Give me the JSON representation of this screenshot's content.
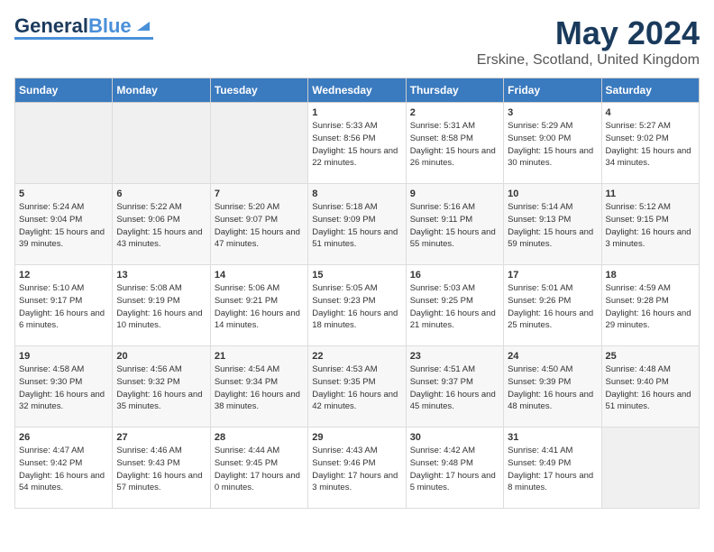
{
  "header": {
    "logo_line1": "General",
    "logo_line2": "Blue",
    "month": "May 2024",
    "location": "Erskine, Scotland, United Kingdom"
  },
  "weekdays": [
    "Sunday",
    "Monday",
    "Tuesday",
    "Wednesday",
    "Thursday",
    "Friday",
    "Saturday"
  ],
  "weeks": [
    [
      {
        "day": "",
        "sunrise": "",
        "sunset": "",
        "daylight": ""
      },
      {
        "day": "",
        "sunrise": "",
        "sunset": "",
        "daylight": ""
      },
      {
        "day": "",
        "sunrise": "",
        "sunset": "",
        "daylight": ""
      },
      {
        "day": "1",
        "sunrise": "Sunrise: 5:33 AM",
        "sunset": "Sunset: 8:56 PM",
        "daylight": "Daylight: 15 hours and 22 minutes."
      },
      {
        "day": "2",
        "sunrise": "Sunrise: 5:31 AM",
        "sunset": "Sunset: 8:58 PM",
        "daylight": "Daylight: 15 hours and 26 minutes."
      },
      {
        "day": "3",
        "sunrise": "Sunrise: 5:29 AM",
        "sunset": "Sunset: 9:00 PM",
        "daylight": "Daylight: 15 hours and 30 minutes."
      },
      {
        "day": "4",
        "sunrise": "Sunrise: 5:27 AM",
        "sunset": "Sunset: 9:02 PM",
        "daylight": "Daylight: 15 hours and 34 minutes."
      }
    ],
    [
      {
        "day": "5",
        "sunrise": "Sunrise: 5:24 AM",
        "sunset": "Sunset: 9:04 PM",
        "daylight": "Daylight: 15 hours and 39 minutes."
      },
      {
        "day": "6",
        "sunrise": "Sunrise: 5:22 AM",
        "sunset": "Sunset: 9:06 PM",
        "daylight": "Daylight: 15 hours and 43 minutes."
      },
      {
        "day": "7",
        "sunrise": "Sunrise: 5:20 AM",
        "sunset": "Sunset: 9:07 PM",
        "daylight": "Daylight: 15 hours and 47 minutes."
      },
      {
        "day": "8",
        "sunrise": "Sunrise: 5:18 AM",
        "sunset": "Sunset: 9:09 PM",
        "daylight": "Daylight: 15 hours and 51 minutes."
      },
      {
        "day": "9",
        "sunrise": "Sunrise: 5:16 AM",
        "sunset": "Sunset: 9:11 PM",
        "daylight": "Daylight: 15 hours and 55 minutes."
      },
      {
        "day": "10",
        "sunrise": "Sunrise: 5:14 AM",
        "sunset": "Sunset: 9:13 PM",
        "daylight": "Daylight: 15 hours and 59 minutes."
      },
      {
        "day": "11",
        "sunrise": "Sunrise: 5:12 AM",
        "sunset": "Sunset: 9:15 PM",
        "daylight": "Daylight: 16 hours and 3 minutes."
      }
    ],
    [
      {
        "day": "12",
        "sunrise": "Sunrise: 5:10 AM",
        "sunset": "Sunset: 9:17 PM",
        "daylight": "Daylight: 16 hours and 6 minutes."
      },
      {
        "day": "13",
        "sunrise": "Sunrise: 5:08 AM",
        "sunset": "Sunset: 9:19 PM",
        "daylight": "Daylight: 16 hours and 10 minutes."
      },
      {
        "day": "14",
        "sunrise": "Sunrise: 5:06 AM",
        "sunset": "Sunset: 9:21 PM",
        "daylight": "Daylight: 16 hours and 14 minutes."
      },
      {
        "day": "15",
        "sunrise": "Sunrise: 5:05 AM",
        "sunset": "Sunset: 9:23 PM",
        "daylight": "Daylight: 16 hours and 18 minutes."
      },
      {
        "day": "16",
        "sunrise": "Sunrise: 5:03 AM",
        "sunset": "Sunset: 9:25 PM",
        "daylight": "Daylight: 16 hours and 21 minutes."
      },
      {
        "day": "17",
        "sunrise": "Sunrise: 5:01 AM",
        "sunset": "Sunset: 9:26 PM",
        "daylight": "Daylight: 16 hours and 25 minutes."
      },
      {
        "day": "18",
        "sunrise": "Sunrise: 4:59 AM",
        "sunset": "Sunset: 9:28 PM",
        "daylight": "Daylight: 16 hours and 29 minutes."
      }
    ],
    [
      {
        "day": "19",
        "sunrise": "Sunrise: 4:58 AM",
        "sunset": "Sunset: 9:30 PM",
        "daylight": "Daylight: 16 hours and 32 minutes."
      },
      {
        "day": "20",
        "sunrise": "Sunrise: 4:56 AM",
        "sunset": "Sunset: 9:32 PM",
        "daylight": "Daylight: 16 hours and 35 minutes."
      },
      {
        "day": "21",
        "sunrise": "Sunrise: 4:54 AM",
        "sunset": "Sunset: 9:34 PM",
        "daylight": "Daylight: 16 hours and 38 minutes."
      },
      {
        "day": "22",
        "sunrise": "Sunrise: 4:53 AM",
        "sunset": "Sunset: 9:35 PM",
        "daylight": "Daylight: 16 hours and 42 minutes."
      },
      {
        "day": "23",
        "sunrise": "Sunrise: 4:51 AM",
        "sunset": "Sunset: 9:37 PM",
        "daylight": "Daylight: 16 hours and 45 minutes."
      },
      {
        "day": "24",
        "sunrise": "Sunrise: 4:50 AM",
        "sunset": "Sunset: 9:39 PM",
        "daylight": "Daylight: 16 hours and 48 minutes."
      },
      {
        "day": "25",
        "sunrise": "Sunrise: 4:48 AM",
        "sunset": "Sunset: 9:40 PM",
        "daylight": "Daylight: 16 hours and 51 minutes."
      }
    ],
    [
      {
        "day": "26",
        "sunrise": "Sunrise: 4:47 AM",
        "sunset": "Sunset: 9:42 PM",
        "daylight": "Daylight: 16 hours and 54 minutes."
      },
      {
        "day": "27",
        "sunrise": "Sunrise: 4:46 AM",
        "sunset": "Sunset: 9:43 PM",
        "daylight": "Daylight: 16 hours and 57 minutes."
      },
      {
        "day": "28",
        "sunrise": "Sunrise: 4:44 AM",
        "sunset": "Sunset: 9:45 PM",
        "daylight": "Daylight: 17 hours and 0 minutes."
      },
      {
        "day": "29",
        "sunrise": "Sunrise: 4:43 AM",
        "sunset": "Sunset: 9:46 PM",
        "daylight": "Daylight: 17 hours and 3 minutes."
      },
      {
        "day": "30",
        "sunrise": "Sunrise: 4:42 AM",
        "sunset": "Sunset: 9:48 PM",
        "daylight": "Daylight: 17 hours and 5 minutes."
      },
      {
        "day": "31",
        "sunrise": "Sunrise: 4:41 AM",
        "sunset": "Sunset: 9:49 PM",
        "daylight": "Daylight: 17 hours and 8 minutes."
      },
      {
        "day": "",
        "sunrise": "",
        "sunset": "",
        "daylight": ""
      }
    ]
  ]
}
